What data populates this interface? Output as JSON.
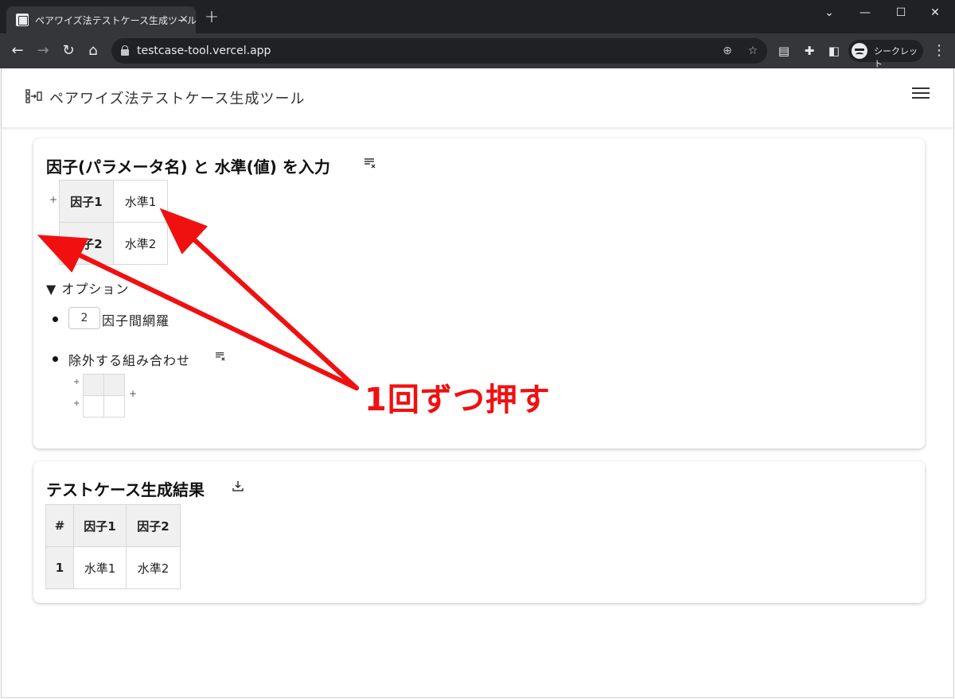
{
  "browser": {
    "tab_title": "ペアワイズ法テストケース生成ツール",
    "tab_close": "✕",
    "new_tab": "+",
    "url": "testcase-tool.vercel.app",
    "profile_label": "シークレット",
    "icons": [
      "back-icon",
      "forward-icon",
      "reload-icon",
      "home-icon",
      "lock-icon",
      "zoom-icon",
      "bookmark-star-icon",
      "cast-icon",
      "extensions-icon",
      "side-panel-icon",
      "incognito-icon",
      "menu-icon"
    ]
  },
  "app": {
    "title": "ペアワイズ法テストケース生成ツール"
  },
  "input_card": {
    "heading": "因子(パラメータ名) と 水準(値) を入力",
    "rows": [
      {
        "factor": "因子1",
        "level": "水準1"
      },
      {
        "factor": "因子2",
        "level": "水準2"
      }
    ],
    "add_mark": "+",
    "options": {
      "summary": "▼ オプション",
      "coverage_value": "2",
      "coverage_label": "因子間網羅",
      "exclude_label": "除外する組み合わせ"
    }
  },
  "result_card": {
    "heading": "テストケース生成結果",
    "headers": [
      "#",
      "因子1",
      "因子2"
    ],
    "rows": [
      [
        "1",
        "水準1",
        "水準2"
      ]
    ]
  },
  "annotation": {
    "text": "1回ずつ押す",
    "color": "#f01010"
  }
}
